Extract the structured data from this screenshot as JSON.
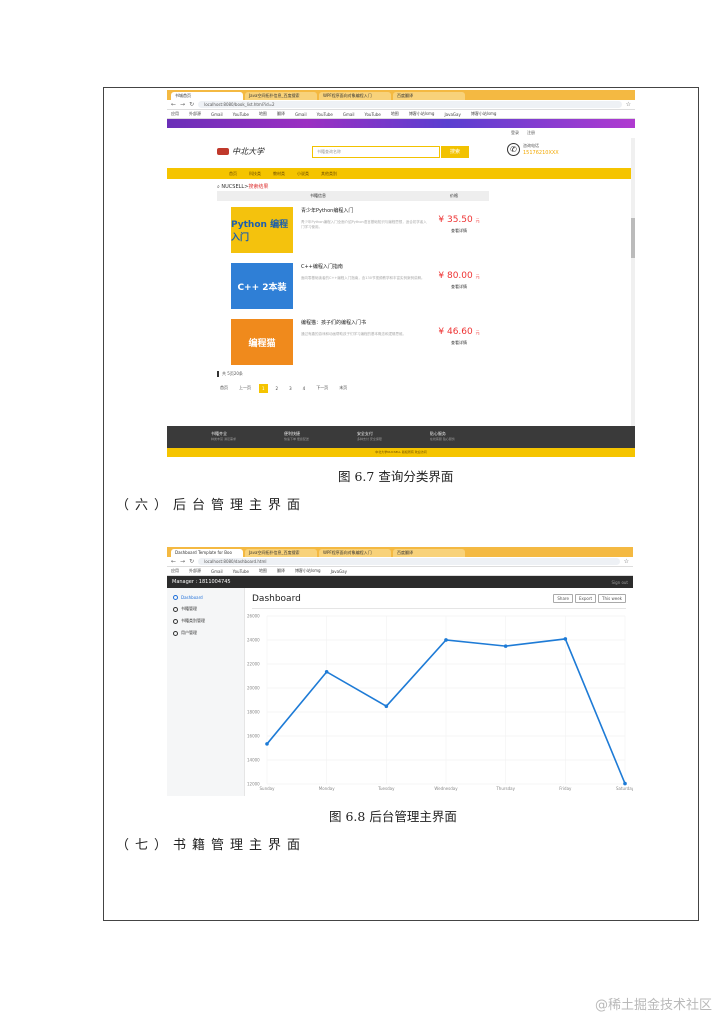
{
  "figure1": {
    "caption": "图 6.7 查询分类界面",
    "browser": {
      "tabs": [
        "书城首页",
        "Java空间拓扑信息_百度搜索",
        "WPF程序面向对象编程入门",
        "百度翻译"
      ],
      "address": "localhost:8080/book_list.html?id=2",
      "bookmarks": [
        "应用",
        "外部源",
        "Gmail",
        "YouTube",
        "地图",
        "翻译",
        "Gmail",
        "YouTube",
        "Gmail",
        "YouTube",
        "地图",
        "博客小站lsmg",
        "JavaGay",
        "博客小站lsmg"
      ]
    },
    "top_links": [
      "登录",
      "注册"
    ],
    "logo_text": "中北大学",
    "search_placeholder": "书籍查询名称",
    "search_button": "搜索",
    "phone_label": "咨询电话",
    "phone_number": "15176210XXX",
    "nav": [
      "首页",
      "科技类",
      "教材类",
      "小说类",
      "其他类别"
    ],
    "crumb_prefix": "NUCSELL>",
    "crumb_red": "搜索结果",
    "list_header": {
      "info": "书籍信息",
      "price": "价格"
    },
    "books": [
      {
        "title": "青少年Python编程入门",
        "cover_text": "Python 编程入门",
        "cover_color": "#f4c20d",
        "price": "¥ 35.50",
        "unit": "元",
        "detail": "查看详情",
        "desc": "青少年Python编程入门全面介绍Python语言基础知识与编程思想，适合初学者入门学习使用。"
      },
      {
        "title": "C++编程入门指南",
        "cover_text": "C++ 2本装",
        "cover_color": "#2f7fd6",
        "price": "¥ 80.00",
        "unit": "元",
        "detail": "查看详情",
        "desc": "面向零基础读者的C++编程入门指南，含130节视频教学和丰富实例案例讲解。"
      },
      {
        "title": "编程猫：孩子们的编程入门书",
        "cover_text": "编程猫",
        "cover_color": "#f08a1c",
        "price": "¥ 46.60",
        "unit": "元",
        "detail": "查看详情",
        "desc": "通过有趣的游戏和动画帮助孩子们学习编程的基本概念和逻辑思维。"
      }
    ],
    "count_text": "共 5页20条",
    "pager": [
      "首页",
      "上一页",
      "1",
      "2",
      "3",
      "4",
      "下一页",
      "末页"
    ],
    "footer": [
      {
        "title": "书籍齐全",
        "sub": "种类丰富 满足需求"
      },
      {
        "title": "便利快捷",
        "sub": "快速下单 便捷配送"
      },
      {
        "title": "安全支付",
        "sub": "多种支付 安全保障"
      },
      {
        "title": "贴心服务",
        "sub": "在线客服 贴心服务"
      }
    ],
    "footer_bar": "中北大学NUCSELL 版权所有 欢迎访问"
  },
  "section6": "（六）后台管理主界面",
  "figure2": {
    "caption": "图 6.8 后台管理主界面",
    "browser": {
      "tabs": [
        "Dashboard Template for Boo",
        "Java空间拓扑信息_百度搜索",
        "WPF程序面向对象编程入门",
        "百度翻译"
      ],
      "address": "localhost:8080/dashboard.html"
    },
    "manager": "Manager : 1811004745",
    "sign_out": "Sign out",
    "sidebar": [
      "Dashboard",
      "书籍管理",
      "书籍类别管理",
      "用户管理"
    ],
    "title": "Dashboard",
    "buttons": [
      "Share",
      "Export",
      "This week"
    ]
  },
  "section7": "（七）书籍管理主界面",
  "watermark": "@稀土掘金技术社区",
  "chart_data": {
    "type": "line",
    "categories": [
      "Sunday",
      "Monday",
      "Tuesday",
      "Wednesday",
      "Thursday",
      "Friday",
      "Saturday"
    ],
    "values": [
      15339,
      21345,
      18483,
      24003,
      23489,
      24092,
      12034
    ],
    "y_ticks": [
      "26000",
      "24000",
      "22000",
      "20000",
      "18000",
      "16000",
      "14000",
      "12000"
    ],
    "ylim": [
      12000,
      26000
    ],
    "color": "#1e7bd6"
  }
}
